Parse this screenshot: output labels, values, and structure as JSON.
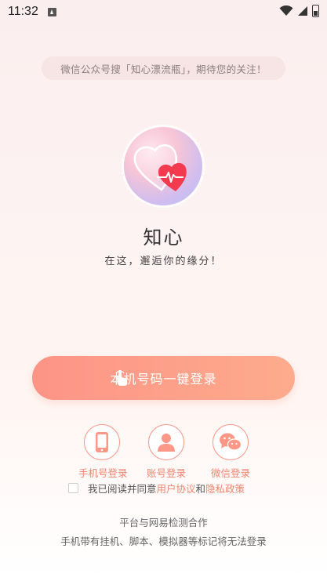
{
  "status": {
    "time": "11:32"
  },
  "notice": {
    "text": "微信公众号搜「知心漂流瓶」，期待您的关注！"
  },
  "app": {
    "name": "知心",
    "slogan": "在这，邂逅你的缘分！"
  },
  "main_button": {
    "label": "本机号码一键登录"
  },
  "login_options": [
    {
      "label": "手机号登录",
      "icon": "phone-icon"
    },
    {
      "label": "账号登录",
      "icon": "person-icon"
    },
    {
      "label": "微信登录",
      "icon": "wechat-icon"
    }
  ],
  "agreement": {
    "prefix": "我已阅读并同意",
    "user_agreement": "用户协议",
    "and": "和",
    "privacy_policy": "隐私政策"
  },
  "footer": {
    "line1": "平台与网易检测合作",
    "line2": "手机带有挂机、脚本、模拟器等标记将无法登录"
  },
  "colors": {
    "accent": "#f1856f",
    "button_start": "#fd9486",
    "button_end": "#fdab8d"
  }
}
